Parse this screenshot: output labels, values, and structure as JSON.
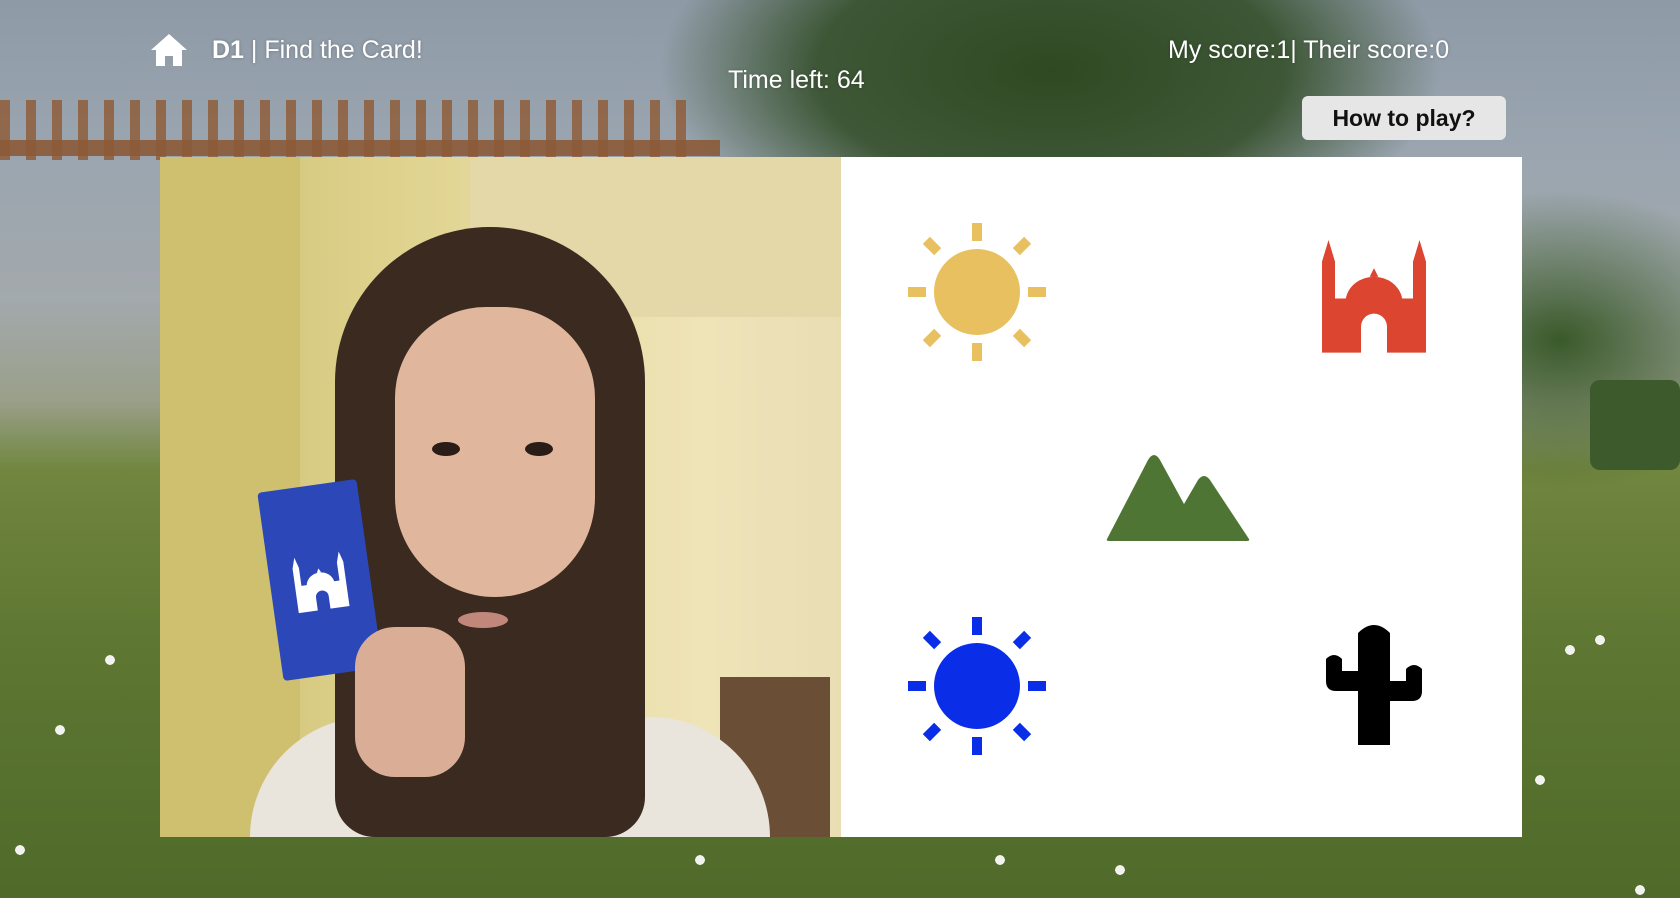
{
  "header": {
    "level": "D1",
    "separator": " | ",
    "title": "Find the Card!",
    "home_icon": "home-icon"
  },
  "timer": {
    "label": "Time left: ",
    "value": "64"
  },
  "score": {
    "text": "My score:1| Their score:0"
  },
  "help": {
    "label": "How to play?"
  },
  "video": {
    "held_card_symbol": "mosque-icon",
    "held_card_color": "#2c48b8"
  },
  "cards": [
    {
      "symbol": "sun-icon",
      "color": "#e8c060"
    },
    {
      "symbol": "mosque-icon",
      "color": "#dc4530"
    },
    {
      "symbol": "mountains-icon",
      "color": "#4f7534"
    },
    {
      "symbol": "sun-icon",
      "color": "#0a2ee8"
    },
    {
      "symbol": "cactus-icon",
      "color": "#000000"
    }
  ]
}
